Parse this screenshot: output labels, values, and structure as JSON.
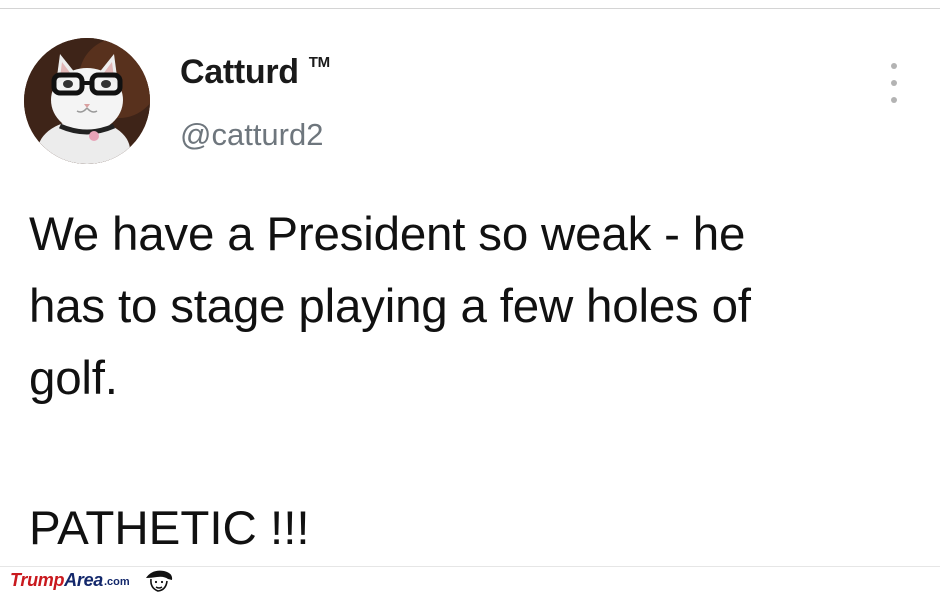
{
  "tweet": {
    "display_name": "Catturd",
    "badge": "TM",
    "handle": "@catturd2",
    "text": "We have a President so weak - he\nhas to stage playing a few holes of\ngolf.",
    "text_2": "PATHETIC !!!",
    "more_icon": "more-vertical-icon"
  },
  "watermark": {
    "brand_part1": "Trump",
    "brand_part2": "Area",
    "brand_suffix": ".com"
  },
  "colors": {
    "handle_gray": "#6e767d",
    "watermark_red": "#c9191e",
    "watermark_navy": "#13286b"
  }
}
